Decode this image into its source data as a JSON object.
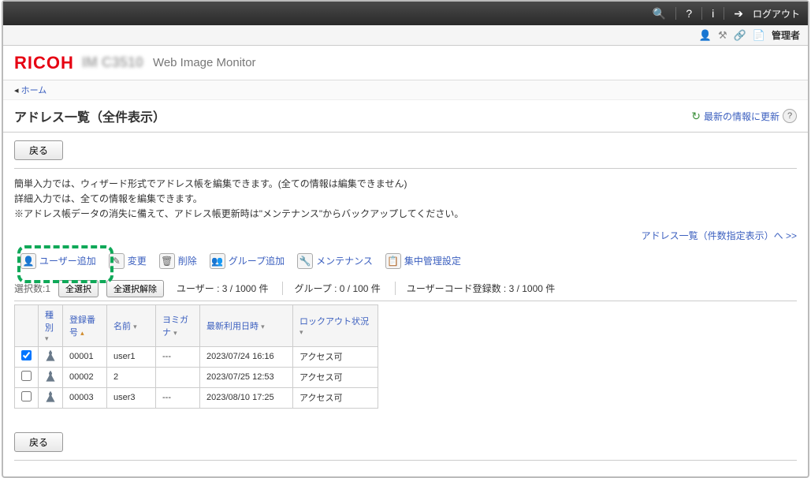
{
  "top": {
    "logout": "ログアウト"
  },
  "subbar": {
    "admin": "管理者"
  },
  "header": {
    "logo": "RICOH",
    "model": "IM C3510",
    "product": "Web Image Monitor"
  },
  "breadcrumb": {
    "home": "ホーム"
  },
  "page_title": "アドレス一覧（全件表示）",
  "refresh_label": "最新の情報に更新",
  "back_label": "戻る",
  "desc": {
    "line1": "簡単入力では、ウィザード形式でアドレス帳を編集できます。(全ての情報は編集できません)",
    "line2": "詳細入力では、全ての情報を編集できます。",
    "line3": "※アドレス帳データの消失に備えて、アドレス帳更新時は\"メンテナンス\"からバックアップしてください。"
  },
  "link_right": "アドレス一覧（件数指定表示）へ >>",
  "toolbar": {
    "add_user": "ユーザー追加",
    "change": "変更",
    "delete": "削除",
    "add_group": "グループ追加",
    "maintenance": "メンテナンス",
    "batch": "集中管理設定"
  },
  "sel": {
    "count_label": "選択数:1",
    "select_all": "全選択",
    "deselect_all": "全選択解除",
    "stat_user": "ユーザー : 3 / 1000 件",
    "stat_group": "グループ : 0 / 100 件",
    "stat_usercode": "ユーザーコード登録数 : 3 / 1000 件"
  },
  "table": {
    "headers": {
      "type": "種別",
      "reg": "登録番号",
      "name": "名前",
      "yomi": "ヨミガナ",
      "date": "最新利用日時",
      "lock": "ロックアウト状況"
    },
    "rows": [
      {
        "checked": true,
        "reg": "00001",
        "name": "user1",
        "yomi": "---",
        "date": "2023/07/24 16:16",
        "lock": "アクセス可"
      },
      {
        "checked": false,
        "reg": "00002",
        "name": "2",
        "yomi": "",
        "date": "2023/07/25 12:53",
        "lock": "アクセス可"
      },
      {
        "checked": false,
        "reg": "00003",
        "name": "user3",
        "yomi": "---",
        "date": "2023/08/10 17:25",
        "lock": "アクセス可"
      }
    ]
  }
}
